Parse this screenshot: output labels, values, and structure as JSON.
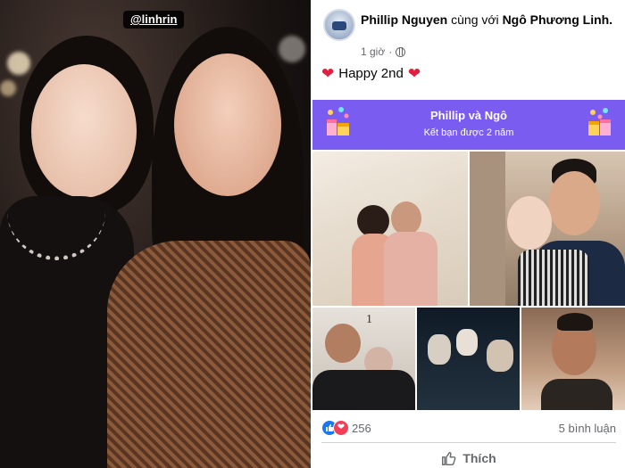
{
  "story": {
    "mention": "@linhrin"
  },
  "post": {
    "author": "Phillip Nguyen",
    "with_text": "cùng với",
    "tagged": "Ngô Phương Linh.",
    "time": "1 giờ",
    "text": "Happy 2nd",
    "banner": {
      "title": "Phillip và Ngô",
      "subtitle": "Kết bạn được 2 năm",
      "color": "#7b5cf0"
    },
    "reactions": {
      "count": "256",
      "icons": [
        "like-icon",
        "love-icon"
      ]
    },
    "comments": "5 bình luận",
    "like_label": "Thích"
  },
  "colors": {
    "accent": "#1877f2",
    "heart": "#e41e3f",
    "muted": "#65676b"
  }
}
